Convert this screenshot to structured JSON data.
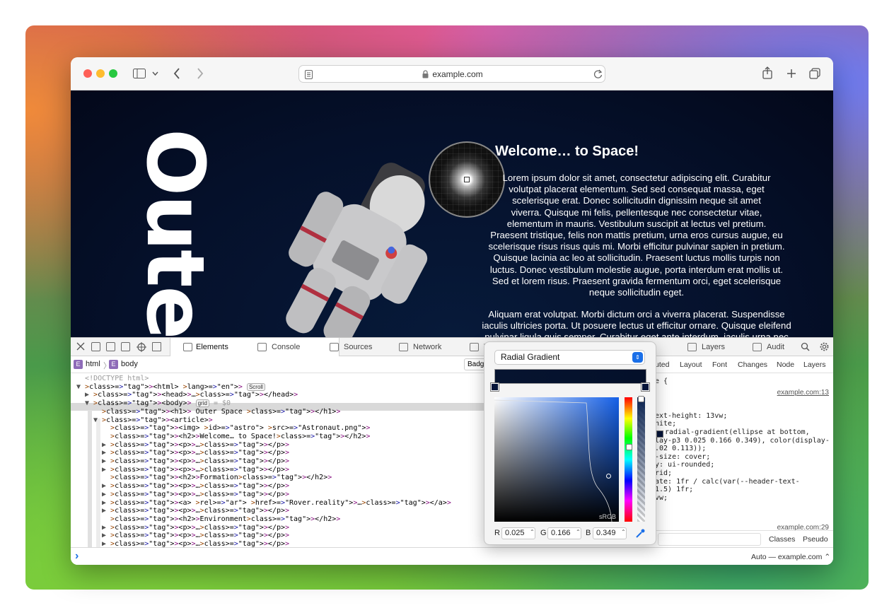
{
  "browser": {
    "url": "example.com"
  },
  "page": {
    "vertical_heading": "Oute",
    "article_title": "Welcome… to Space!",
    "paragraph1": [
      "Lorem ipsum dolor sit amet, consectetur adipiscing elit. Curabitur",
      "volutpat placerat elementum. Sed sed consequat massa, eget",
      "scelerisque erat. Donec sollicitudin dignissim neque sit amet",
      "viverra. Quisque mi felis, pellentesque nec consectetur vitae,",
      "elementum in mauris. Vestibulum suscipit at lectus vel pretium.",
      "Praesent tristique, felis non mattis pretium, urna eros cursus augue, eu",
      "scelerisque risus risus quis mi. Morbi efficitur pulvinar sapien in pretium.",
      "Quisque lacinia ac leo at sollicitudin. Praesent luctus mollis turpis non",
      "luctus. Donec vestibulum molestie augue, porta interdum erat mollis ut.",
      "Sed et lorem risus. Praesent gravida fermentum orci, eget scelerisque",
      "neque sollicitudin eget."
    ],
    "paragraph2": [
      "Aliquam erat volutpat. Morbi dictum orci a viverra placerat. Suspendisse",
      "iaculis ultricies porta. Ut posuere lectus ut efficitur ornare. Quisque eleifend",
      "pulvinar ligula quis semper. Curabitur eget ante interdum, iaculis urna nec"
    ]
  },
  "devtools": {
    "tabs": [
      {
        "label": "Elements",
        "icon": "elements-icon"
      },
      {
        "label": "Console",
        "icon": "console-icon"
      },
      {
        "label": "Sources",
        "icon": "sources-icon"
      },
      {
        "label": "Network",
        "icon": "network-icon"
      },
      {
        "label": "T",
        "icon": "timelines-icon"
      },
      {
        "label": "Layers",
        "icon": "layers-icon"
      },
      {
        "label": "Audit",
        "icon": "audit-icon"
      }
    ],
    "breadcrumbs": [
      "html",
      "body"
    ],
    "badge_field": "Badg",
    "side_tabs": [
      "uted",
      "Layout",
      "Font",
      "Changes",
      "Node",
      "Layers"
    ],
    "dom_lines": [
      "<!DOCTYPE html>",
      "<html lang=\"en\">",
      "<head>…</head>",
      "<body>",
      "<h1> Outer Space </h1>",
      "<article>",
      "<img id=\"astro\" src=\"Astronaut.png\">",
      "<h2>Welcome… to Space!</h2>",
      "<p>…</p>",
      "<p>…</p>",
      "<p>…</p>",
      "<p>…</p>",
      "<h2>Formation</h2>",
      "<p>…</p>",
      "<p>…</p>",
      "<a rel=\"ar\" href=\"Rover.reality\">…</a>",
      "<p>…</p>",
      "<h2>Environment</h2>",
      "<p>…</p>",
      "<p>…</p>",
      "<p>…</p>"
    ],
    "pill_scroll": "Scroll",
    "pill_grid": "grid",
    "body_ref": "= $0",
    "style_lines": [
      "e {",
      "",
      "",
      "ext-height: 13vw;",
      "hite;",
      "radial-gradient(ellipse at bottom,",
      "lay-p3 0.025 0.166 0.349), color(display-",
      ".02 0.113));",
      "-size: cover;",
      "y: ui-rounded;",
      "rid;",
      "ate: 1fr / calc(var(--header-text-",
      "1.5) 1fr;",
      "vw;"
    ],
    "style_link1": "example.com:13",
    "style_link2": "example.com:29",
    "classes_label": "Classes",
    "pseudo_label": "Pseudo",
    "console_prompt": "›",
    "context_select": "Auto — example.com"
  },
  "color_picker": {
    "mode": "Radial Gradient",
    "gamut_label": "sRGB",
    "r_label": "R",
    "r_value": "0.025",
    "g_label": "G",
    "g_value": "0.166",
    "b_label": "B",
    "b_value": "0.349"
  }
}
